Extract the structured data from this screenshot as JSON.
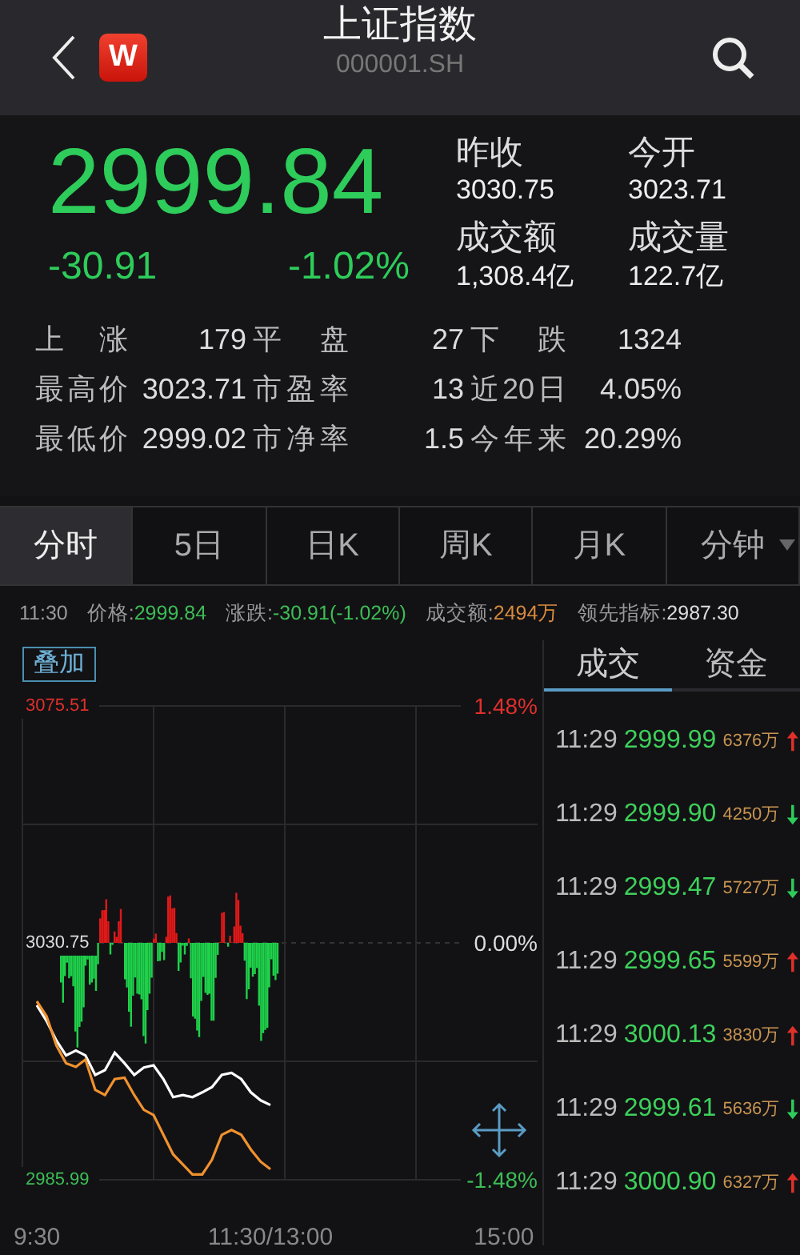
{
  "header": {
    "logo": "W",
    "title": "上证指数",
    "code": "000001.SH"
  },
  "quote": {
    "price": "2999.84",
    "change": "-30.91",
    "change_pct": "-1.02%",
    "color": "#2ecc5a"
  },
  "summary": [
    {
      "label": "昨收",
      "value": "3030.75"
    },
    {
      "label": "今开",
      "value": "3023.71"
    },
    {
      "label": "成交额",
      "value": "1,308.4亿"
    },
    {
      "label": "成交量",
      "value": "122.7亿"
    }
  ],
  "stats": [
    [
      {
        "label": "上涨",
        "value": "179"
      },
      {
        "label": "平盘",
        "value": "27"
      },
      {
        "label": "下跌",
        "value": "1324"
      }
    ],
    [
      {
        "label": "最高价",
        "value": "3023.71"
      },
      {
        "label": "市盈率",
        "value": "13"
      },
      {
        "label": "近20日",
        "value": "4.05%"
      }
    ],
    [
      {
        "label": "最低价",
        "value": "2999.02"
      },
      {
        "label": "市净率",
        "value": "1.5"
      },
      {
        "label": "今年来",
        "value": "20.29%"
      }
    ]
  ],
  "period_tabs": [
    {
      "label": "分时",
      "selected": true,
      "dropdown": false
    },
    {
      "label": "5日",
      "selected": false,
      "dropdown": false
    },
    {
      "label": "日K",
      "selected": false,
      "dropdown": false
    },
    {
      "label": "周K",
      "selected": false,
      "dropdown": false
    },
    {
      "label": "月K",
      "selected": false,
      "dropdown": false
    },
    {
      "label": "分钟",
      "selected": false,
      "dropdown": true
    }
  ],
  "info_strip": {
    "time": "11:30",
    "items": [
      {
        "label": "价格:",
        "value": "2999.84",
        "color": "#3dbd55"
      },
      {
        "label": "涨跌:",
        "value": "-30.91(-1.02%)",
        "color": "#3dbd55"
      },
      {
        "label": "成交额:",
        "value": "2494万",
        "color": "#d98a3c"
      },
      {
        "label": "领先指标:",
        "value": "2987.30",
        "color": "#dddddd"
      }
    ]
  },
  "overlay_button": "叠加",
  "chart": {
    "right_labels": [
      {
        "label": "1.48%",
        "color": "#e0302a"
      },
      {
        "label": "0.00%",
        "color": "#dddddd"
      },
      {
        "label": "-1.48%",
        "color": "#3dbd55"
      }
    ],
    "chart_data": {
      "type": "line",
      "categories": [
        "9:30",
        null,
        null,
        null,
        null,
        null,
        null,
        null,
        null,
        null,
        null,
        null,
        null,
        null,
        null,
        null,
        null,
        null,
        null,
        null,
        null,
        null,
        null,
        null,
        "11:30/13:00",
        null,
        null,
        null,
        null,
        null,
        null,
        null,
        null,
        null,
        null,
        null,
        null,
        null,
        null,
        null,
        null,
        null,
        null,
        null,
        null,
        null,
        null,
        null,
        "15:00"
      ],
      "series": [
        {
          "color": "#ffffff",
          "values": [
            3019.0,
            3016.0,
            3012.3,
            3009.5,
            3010.4,
            3009.5,
            3005.8,
            3006.7,
            3010.0,
            3008.0,
            3005.8,
            3007.2,
            3007.6,
            3005.0,
            3001.6,
            3002.0,
            3001.6,
            3002.5,
            3003.5,
            3005.8,
            3006.2,
            3005.0,
            3002.5,
            3001.0,
            3000.1,
            null,
            null,
            null,
            null,
            null,
            null,
            null,
            null,
            null,
            null,
            null,
            null,
            null,
            null,
            null,
            null,
            null,
            null,
            null,
            null,
            null,
            null,
            null,
            null
          ]
        },
        {
          "color": "#f0922e",
          "values": [
            3019.7,
            3016.9,
            3011.4,
            3008.0,
            3007.3,
            3008.7,
            3003.0,
            3002.0,
            3005.0,
            3005.3,
            3002.0,
            2999.2,
            2998.2,
            2994.5,
            2990.8,
            2988.9,
            2987.0,
            2987.0,
            2989.8,
            2994.5,
            2995.4,
            2994.5,
            2991.7,
            2989.4,
            2988.0,
            null,
            null,
            null,
            null,
            null,
            null,
            null,
            null,
            null,
            null,
            null,
            null,
            null,
            null,
            null,
            null,
            null,
            null,
            null,
            null,
            null,
            null,
            null,
            null
          ]
        }
      ],
      "ylim": [
        2985.99,
        3075.51
      ],
      "grid": true,
      "yticks": [
        {
          "value": 3075.51,
          "label": "3075.51"
        },
        {
          "value": 3030.75,
          "label": "3030.75"
        },
        {
          "value": 2985.99,
          "label": "2985.99"
        }
      ]
    }
  },
  "trade_tabs": [
    {
      "label": "成交",
      "selected": true
    },
    {
      "label": "资金",
      "selected": false
    }
  ],
  "trades": [
    {
      "time": "11:29",
      "price": "2999.99",
      "volume": "6376万",
      "kind": "up"
    },
    {
      "time": "11:29",
      "price": "2999.90",
      "volume": "4250万",
      "kind": "down"
    },
    {
      "time": "11:29",
      "price": "2999.47",
      "volume": "5727万",
      "kind": "down"
    },
    {
      "time": "11:29",
      "price": "2999.65",
      "volume": "5599万",
      "kind": "up"
    },
    {
      "time": "11:29",
      "price": "3000.13",
      "volume": "3830万",
      "kind": "up"
    },
    {
      "time": "11:29",
      "price": "2999.61",
      "volume": "5636万",
      "kind": "down"
    },
    {
      "time": "11:29",
      "price": "3000.90",
      "volume": "6327万",
      "kind": "up"
    }
  ]
}
